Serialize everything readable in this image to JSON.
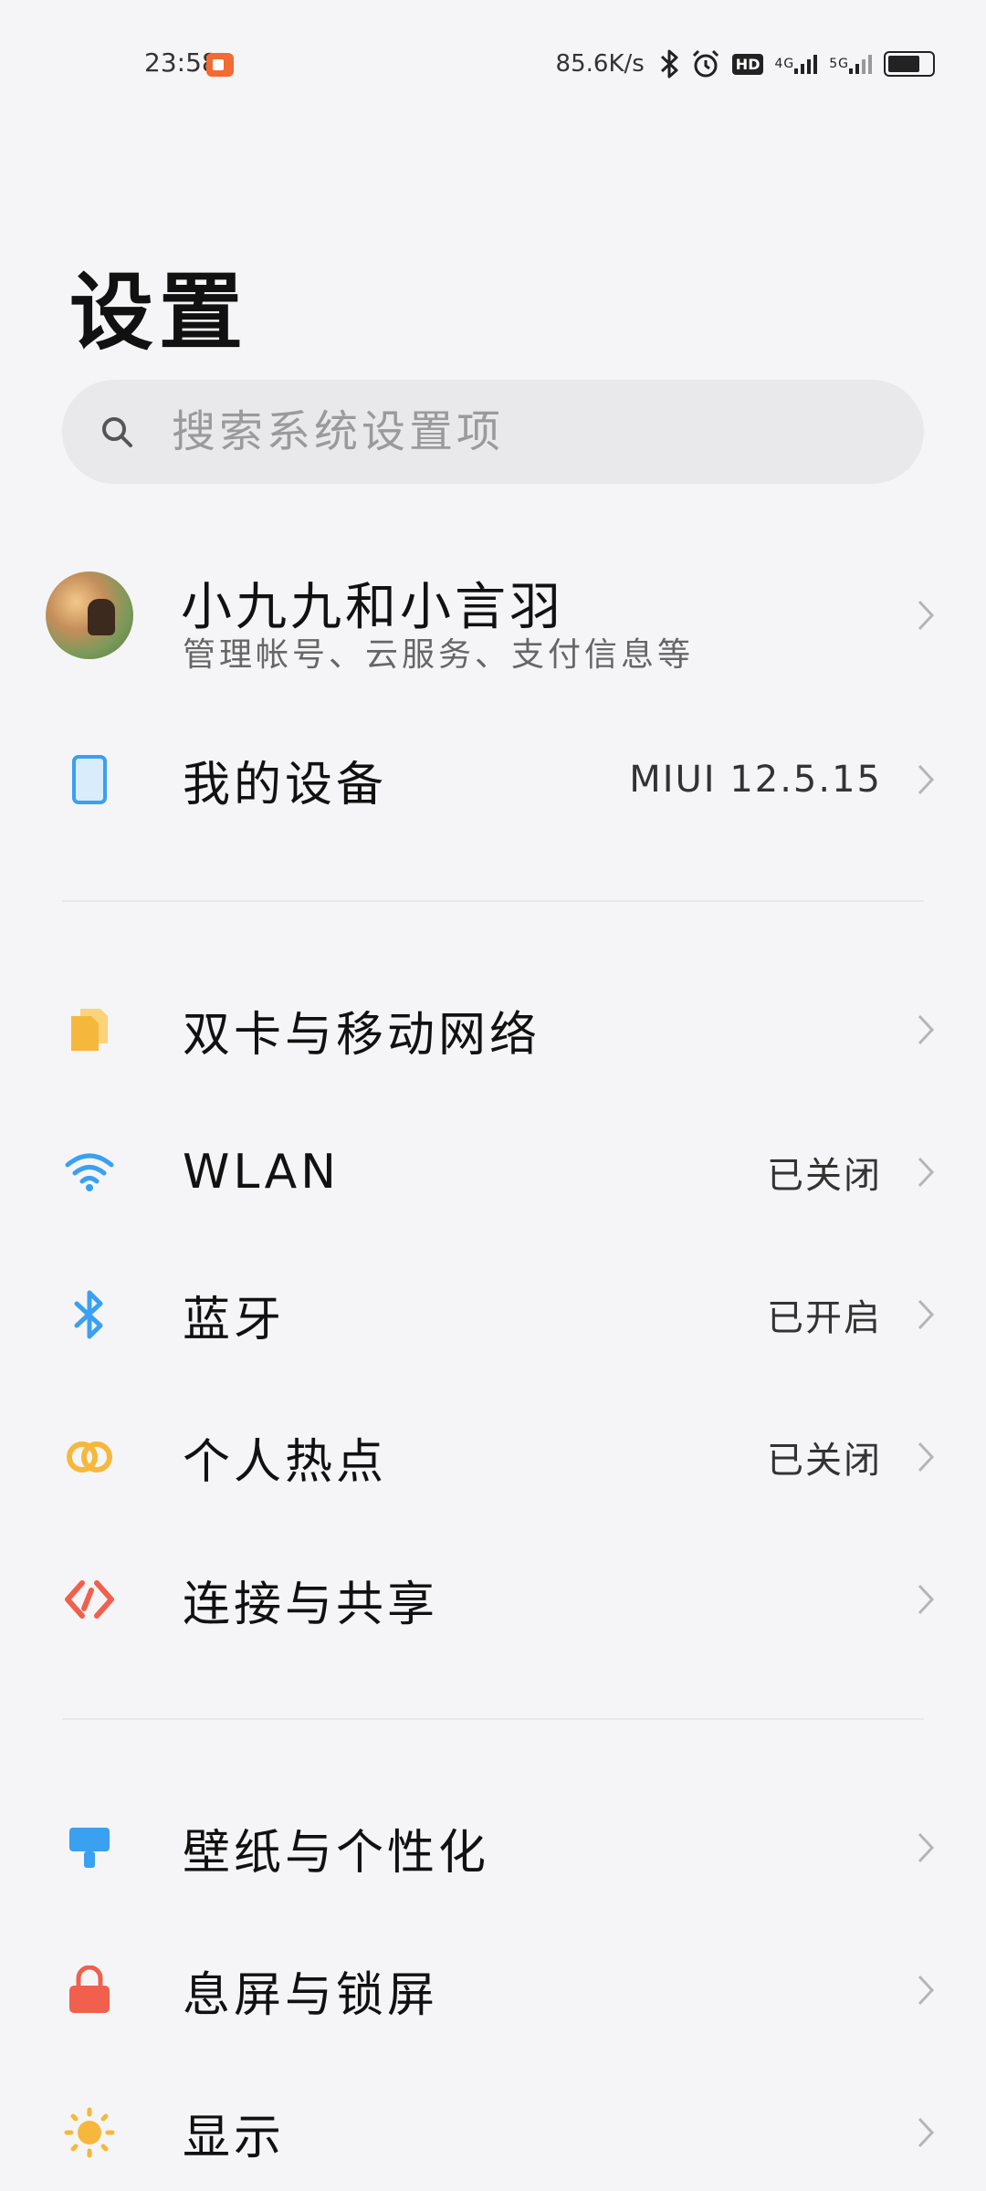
{
  "status_bar": {
    "time": "23:58",
    "net_speed": "85.6K/s",
    "icons": [
      "screen-record-icon",
      "bluetooth-icon",
      "alarm-icon",
      "hd-icon",
      "signal-4g-icon",
      "signal-5g-icon",
      "battery-icon"
    ],
    "hd_label": "HD",
    "signal_1_label": "4G",
    "signal_2_label": "5G"
  },
  "page": {
    "title": "设置"
  },
  "search": {
    "placeholder": "搜索系统设置项"
  },
  "account": {
    "name": "小九九和小言羽",
    "subtitle": "管理帐号、云服务、支付信息等"
  },
  "my_device": {
    "label": "我的设备",
    "value": "MIUI 12.5.15"
  },
  "network_section": [
    {
      "label": "双卡与移动网络",
      "value": "",
      "icon": "sim-card-icon",
      "color": "#f5b83d"
    },
    {
      "label": "WLAN",
      "value": "已关闭",
      "icon": "wifi-icon",
      "color": "#3aa0f0"
    },
    {
      "label": "蓝牙",
      "value": "已开启",
      "icon": "bluetooth-icon",
      "color": "#3aa0f0"
    },
    {
      "label": "个人热点",
      "value": "已关闭",
      "icon": "hotspot-icon",
      "color": "#f5b83d"
    },
    {
      "label": "连接与共享",
      "value": "",
      "icon": "connection-share-icon",
      "color": "#f0604d"
    }
  ],
  "personal_section": [
    {
      "label": "壁纸与个性化",
      "value": "",
      "icon": "wallpaper-icon",
      "color": "#3aa0f0"
    },
    {
      "label": "息屏与锁屏",
      "value": "",
      "icon": "lock-icon",
      "color": "#f0604d"
    },
    {
      "label": "显示",
      "value": "",
      "icon": "brightness-icon",
      "color": "#f5b83d"
    }
  ],
  "colors": {
    "background": "#f5f5f7",
    "search_bg": "#e9e9ec",
    "chevron": "#b5b5b8",
    "device_icon": "#3aa0f0"
  }
}
